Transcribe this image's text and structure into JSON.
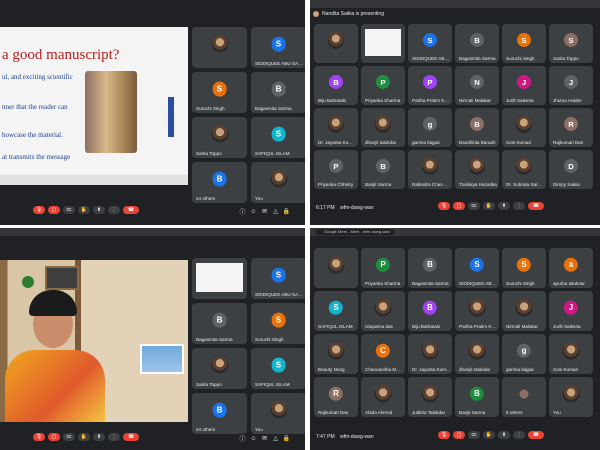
{
  "colors": {
    "blue": "#1a73e8",
    "orange": "#e8710a",
    "teal": "#12b5cb",
    "green": "#1e8e3e",
    "purple": "#a142f4",
    "pink": "#d01884",
    "gray": "#5f6368",
    "brown": "#8d6e63",
    "red": "#ea4335"
  },
  "q1": {
    "slide": {
      "title": "a good manuscript?",
      "lines": [
        "ul, and exciting scientific",
        "nner that the reader can",
        "howcase the material.",
        "at transmits the message"
      ]
    },
    "tiles": [
      {
        "name": "",
        "initial": "",
        "color": "",
        "photo": true,
        "label": ""
      },
      {
        "name": "SIDDIQUEE ABU SAY...",
        "initial": "S",
        "color": "blue"
      },
      {
        "name": "Suruchi Singh",
        "initial": "S",
        "color": "orange"
      },
      {
        "name": "Bagasmita Sarma",
        "initial": "B",
        "color": "gray"
      },
      {
        "name": "Sarita Toppo",
        "initial": "",
        "color": "",
        "photo": true
      },
      {
        "name": "SAFIQUL ISLAM",
        "initial": "S",
        "color": "teal"
      },
      {
        "name": "24 others",
        "initial": "B",
        "color": "blue",
        "others": true
      },
      {
        "name": "You",
        "initial": "",
        "color": "",
        "photo": true
      }
    ]
  },
  "q2": {
    "presenting": "Nandita Saikia is presenting",
    "time": "6:17 PM",
    "code": "wfm-duwg-wan",
    "tiles": [
      {
        "name": "",
        "photo": true
      },
      {
        "name": "",
        "slide": true
      },
      {
        "name": "SIDDIQUEE ABU S...",
        "initial": "S",
        "color": "blue"
      },
      {
        "name": "Bagasmita Sarma",
        "initial": "B",
        "color": "gray"
      },
      {
        "name": "Suruchi Singh",
        "initial": "S",
        "color": "orange"
      },
      {
        "name": "Sarita Toppo",
        "initial": "S",
        "color": "brown"
      },
      {
        "name": "Biju Barkataki",
        "initial": "B",
        "color": "purple"
      },
      {
        "name": "Priyanka Sharma",
        "initial": "P",
        "color": "green"
      },
      {
        "name": "Partha Pratim Kal...",
        "initial": "P",
        "color": "purple"
      },
      {
        "name": "Nirmali Malakar",
        "initial": "N",
        "color": "gray"
      },
      {
        "name": "Jurilt Saikeria",
        "initial": "J",
        "color": "pink"
      },
      {
        "name": "Jhuma Halder",
        "initial": "J",
        "color": "gray"
      },
      {
        "name": "Dr. Jayanta Kuma...",
        "initial": "",
        "photo": true
      },
      {
        "name": "dhanjit talukdar",
        "initial": "",
        "photo": true
      },
      {
        "name": "garima bajpai",
        "initial": "g",
        "color": "gray"
      },
      {
        "name": "Bandhitita Baruah",
        "initial": "B",
        "color": "brown"
      },
      {
        "name": "Soni Kumari",
        "initial": "",
        "photo": true
      },
      {
        "name": "Rajkumari Das",
        "initial": "R",
        "color": "brown"
      },
      {
        "name": "Priyanka Chhetry",
        "initial": "P",
        "color": "gray"
      },
      {
        "name": "Banjit Sarma",
        "initial": "B",
        "color": "gray"
      },
      {
        "name": "Rabindra Changm...",
        "initial": "",
        "photo": true
      },
      {
        "name": "Trailokya Hazarika",
        "initial": "",
        "photo": true
      },
      {
        "name": "Dr. Subrata Sarkar",
        "initial": "",
        "photo": true
      },
      {
        "name": "Dimpy Saikia",
        "initial": "D",
        "color": "gray"
      }
    ]
  },
  "q3": {
    "tiles": [
      {
        "name": "",
        "slide": true
      },
      {
        "name": "SIDDIQUEE ABU SAY...",
        "initial": "S",
        "color": "blue"
      },
      {
        "name": "Bagasmita Sarma",
        "initial": "B",
        "color": "gray"
      },
      {
        "name": "Suruchi Singh",
        "initial": "S",
        "color": "orange"
      },
      {
        "name": "Sarita Toppo",
        "initial": "",
        "photo": true
      },
      {
        "name": "SAFIQUL ISLAM",
        "initial": "S",
        "color": "teal"
      },
      {
        "name": "24 others",
        "initial": "B",
        "color": "blue",
        "others": true
      },
      {
        "name": "You",
        "initial": "",
        "photo": true
      }
    ]
  },
  "q4": {
    "tab": "Google Meet - Meet - wfm-duwg-wan",
    "time": "7:47 PM",
    "code": "wfm-duwg-wan",
    "tiles": [
      {
        "name": "",
        "photo": true
      },
      {
        "name": "Priyanka Sharma",
        "initial": "P",
        "color": "green"
      },
      {
        "name": "Bagasmita Sarma",
        "initial": "B",
        "color": "gray"
      },
      {
        "name": "SIDDIQUEE ABU SAY...",
        "initial": "S",
        "color": "blue"
      },
      {
        "name": "Suruchi Singh",
        "initial": "S",
        "color": "orange"
      },
      {
        "name": "apurba talukdar",
        "initial": "a",
        "color": "orange"
      },
      {
        "name": "SAFIQUL ISLAM",
        "initial": "S",
        "color": "teal"
      },
      {
        "name": "nituparna das",
        "initial": "",
        "photo": true
      },
      {
        "name": "Biju Barkataki",
        "initial": "B",
        "color": "purple"
      },
      {
        "name": "Partha Pratim Ka...",
        "initial": "",
        "photo": true
      },
      {
        "name": "Nirmali Malakar",
        "initial": "",
        "photo": true
      },
      {
        "name": "Jurilt Saikeria",
        "initial": "J",
        "color": "pink"
      },
      {
        "name": "Beauty Noog",
        "initial": "",
        "photo": true
      },
      {
        "name": "Chanuanitha Mah...",
        "initial": "C",
        "color": "orange"
      },
      {
        "name": "Dr. Jayanta Kum...",
        "initial": "",
        "photo": true
      },
      {
        "name": "dhanjit talukdar",
        "initial": "",
        "photo": true
      },
      {
        "name": "garima bajpai",
        "initial": "g",
        "color": "gray"
      },
      {
        "name": "Soni Kumari",
        "initial": "",
        "photo": true
      },
      {
        "name": "Rajkumari Das",
        "initial": "R",
        "color": "brown"
      },
      {
        "name": "Abida Ahmed",
        "initial": "",
        "photo": true
      },
      {
        "name": "Jutikha Talukdar",
        "initial": "",
        "photo": true
      },
      {
        "name": "Banjit Sarma",
        "initial": "B",
        "color": "green"
      },
      {
        "name": "9 others",
        "initial": "",
        "others": true
      },
      {
        "name": "You",
        "initial": "",
        "photo": true
      }
    ]
  }
}
